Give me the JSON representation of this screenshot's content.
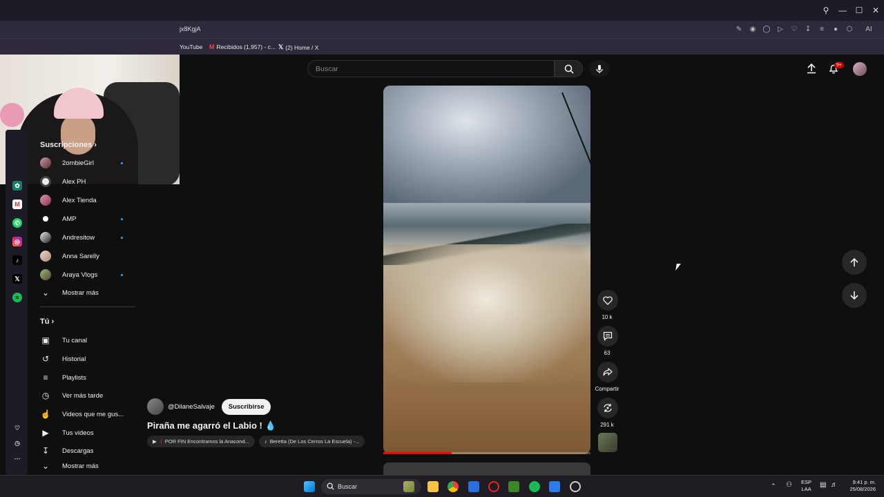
{
  "browser": {
    "url_fragment": "jx8KgjA",
    "ai_label": "AI",
    "bookmarks": [
      {
        "label": "YouTube"
      },
      {
        "label": "Recibidos (1,957) - c..."
      },
      {
        "label": "(2) Home / X"
      }
    ]
  },
  "youtube": {
    "search_placeholder": "Buscar",
    "notification_badge": "9+"
  },
  "sidebar": {
    "subscriptions_title": "Suscripciones",
    "subscriptions": [
      {
        "name": "2ombieGirl",
        "new": true
      },
      {
        "name": "Alex PH",
        "new": false
      },
      {
        "name": "Alex Tienda",
        "new": false
      },
      {
        "name": "AMP",
        "new": true
      },
      {
        "name": "Andresitow",
        "new": true
      },
      {
        "name": "Anna Sarelly",
        "new": false
      },
      {
        "name": "Araya Vlogs",
        "new": true
      }
    ],
    "show_more": "Mostrar más",
    "you_title": "Tú",
    "you_items": [
      {
        "label": "Tu canal",
        "icon": "user-icon"
      },
      {
        "label": "Historial",
        "icon": "history-icon"
      },
      {
        "label": "Playlists",
        "icon": "playlist-icon"
      },
      {
        "label": "Ver más tarde",
        "icon": "clock-icon"
      },
      {
        "label": "Videos que me gus...",
        "icon": "thumb-up-icon"
      },
      {
        "label": "Tus videos",
        "icon": "video-icon"
      },
      {
        "label": "Descargas",
        "icon": "download-icon"
      }
    ],
    "show_more_2": "Mostrar más"
  },
  "short": {
    "channel": "@DilaneSalvaje",
    "subscribe": "Suscribirse",
    "title": "Piraña me agarró el Labio !",
    "chips": [
      "POR FIN Encontramos la Anacond...",
      "Beretta (De Los Cerros La Escuela) -..."
    ],
    "likes": "10 k",
    "comments": "63",
    "share": "Compartir",
    "remix": "291 k",
    "progress": 0.33
  },
  "taskbar": {
    "search": "Buscar",
    "lang_top": "ESP",
    "lang_bottom": "LAA",
    "time": "9:41 p. m.",
    "date": "25/08/2026"
  }
}
